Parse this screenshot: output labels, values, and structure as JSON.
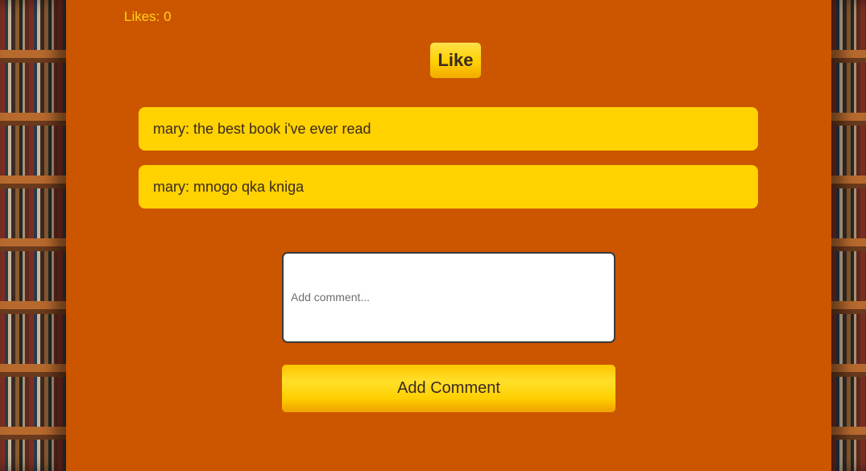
{
  "likes": {
    "label": "Likes: 0"
  },
  "like_button": {
    "label": "Like"
  },
  "comments": [
    {
      "text": "mary: the best book i've ever read"
    },
    {
      "text": "mary: mnogo qka kniga"
    }
  ],
  "comment_form": {
    "placeholder": "Add comment...",
    "value": "",
    "submit_label": "Add Comment"
  },
  "colors": {
    "panel_background": "#cc5500",
    "accent_yellow": "#ffd200",
    "text_dark": "#3b2a20"
  }
}
